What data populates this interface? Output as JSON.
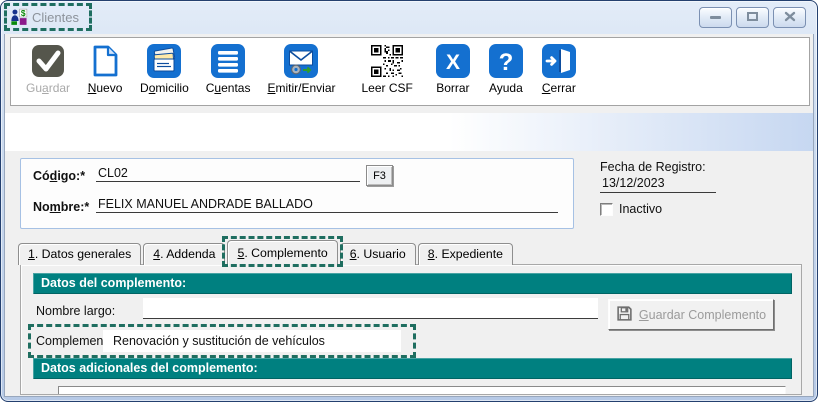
{
  "window": {
    "title": "Clientes"
  },
  "toolbar": {
    "buttons": [
      {
        "label": "Gu&ardar",
        "icon": "save-check-icon",
        "disabled": true
      },
      {
        "label": "&Nuevo",
        "icon": "new-document-icon",
        "disabled": false
      },
      {
        "label": "D&omicilio",
        "icon": "address-cards-icon",
        "disabled": false
      },
      {
        "label": "C&uentas",
        "icon": "accounts-list-icon",
        "disabled": false
      },
      {
        "label": "&Emitir/Enviar",
        "icon": "send-mail-icon",
        "disabled": false
      },
      {
        "label": "Leer CSF",
        "icon": "qr-code-icon",
        "disabled": false
      },
      {
        "label": "Borrar",
        "icon": "delete-x-icon",
        "disabled": false
      },
      {
        "label": "Ayuda",
        "icon": "help-icon",
        "disabled": false
      },
      {
        "label": "&Cerrar",
        "icon": "exit-door-icon",
        "disabled": false
      }
    ]
  },
  "form": {
    "codigo": {
      "label": "Có&digo:*",
      "value": "CL02",
      "lookup_button": "F3"
    },
    "nombre": {
      "label": "No&mbre:*",
      "value": "FELIX MANUEL ANDRADE BALLADO"
    },
    "fecha_registro": {
      "label": "Fecha de Registro:",
      "value": "13/12/2023"
    },
    "inactivo": {
      "label": "Inactivo",
      "checked": false
    }
  },
  "tabs": [
    {
      "label": "&1. Datos generales",
      "selected": false
    },
    {
      "label": "&4. Addenda",
      "selected": false
    },
    {
      "label": "&5. Complemento",
      "selected": true,
      "annotated": true
    },
    {
      "label": "&6. Usuario",
      "selected": false
    },
    {
      "label": "&8. Expediente",
      "selected": false
    }
  ],
  "complemento_tab": {
    "section_header": "Datos del complemento:",
    "nombre_largo": {
      "label": "Nombre largo:",
      "value": ""
    },
    "complemento": {
      "label": "Complemento:",
      "value": "Renovación y sustitución de vehículos"
    },
    "guardar_complemento_button": "&Guardar Complemento",
    "adicionales_header": "Datos adicionales del complemento:"
  },
  "colors": {
    "teal_header": "#008080",
    "annotation_dash": "#1f6e60",
    "toolbar_icon_blue": "#1470d0"
  }
}
